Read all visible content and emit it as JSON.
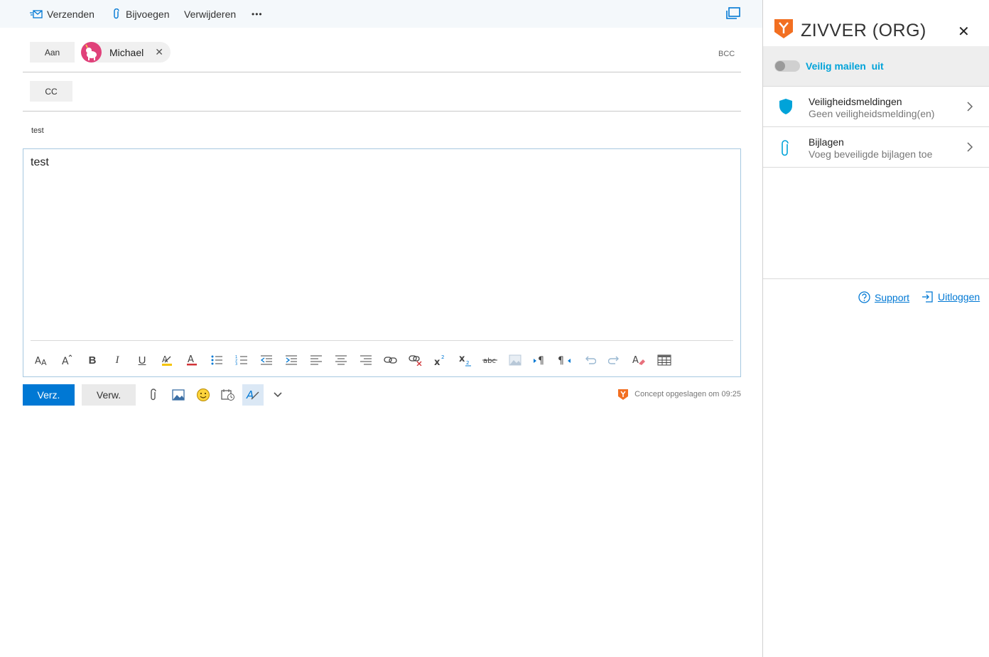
{
  "toolbar": {
    "send": "Verzenden",
    "attach": "Bijvoegen",
    "discard": "Verwijderen",
    "more": "•••"
  },
  "recipients": {
    "to_label": "Aan",
    "to_name": "Michael",
    "cc_label": "CC",
    "bcc_label": "BCC"
  },
  "subject": "test",
  "body": "test",
  "actions": {
    "send": "Verz.",
    "discard": "Verw.",
    "saved_status": "Concept opgeslagen om 09:25"
  },
  "zivver": {
    "title": "ZIVVER (ORG)",
    "close": "✕",
    "toggle_label": "Veilig mailen",
    "toggle_state": "uit",
    "items": [
      {
        "title": "Veiligheidsmeldingen",
        "subtitle": "Geen veiligheidsmelding(en)"
      },
      {
        "title": "Bijlagen",
        "subtitle": "Voeg beveiligde bijlagen toe"
      }
    ],
    "support": "Support",
    "logout": "Uitloggen"
  },
  "colors": {
    "accent": "#0078d4",
    "zivver_orange": "#f26f21",
    "zivver_blue": "#00a3d9"
  }
}
